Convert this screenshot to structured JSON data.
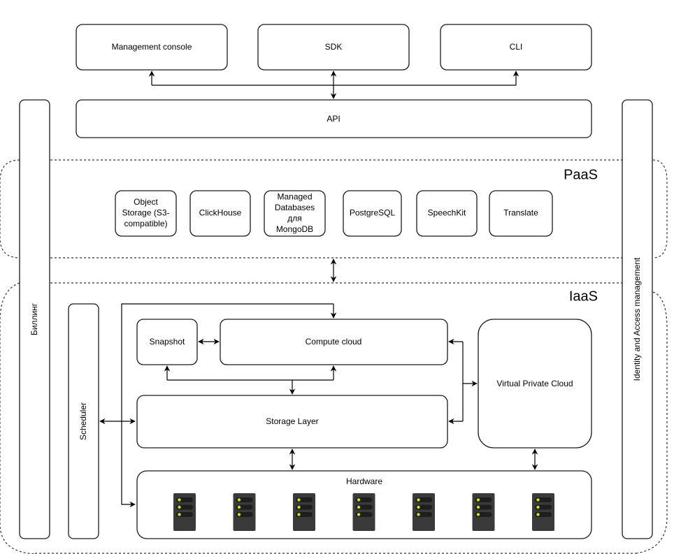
{
  "top": {
    "management_console": "Management console",
    "sdk": "SDK",
    "cli": "CLI",
    "api": "API"
  },
  "sidebars": {
    "billing": "Биллинг",
    "iam": "Identity and Access management"
  },
  "paas": {
    "title": "PaaS",
    "services": [
      {
        "lines": [
          "Object",
          "Storage (S3-",
          "compatible)"
        ]
      },
      {
        "lines": [
          "ClickHouse"
        ]
      },
      {
        "lines": [
          "Managed",
          "Databases",
          "для",
          "MongoDB"
        ]
      },
      {
        "lines": [
          "PostgreSQL"
        ]
      },
      {
        "lines": [
          "SpeechKit"
        ]
      },
      {
        "lines": [
          "Translate"
        ]
      }
    ]
  },
  "iaas": {
    "title": "IaaS",
    "scheduler": "Scheduler",
    "snapshot": "Snapshot",
    "compute_cloud": "Compute cloud",
    "storage_layer": "Storage Layer",
    "vpc": "Virtual Private Cloud",
    "hardware": "Hardware",
    "server_count": 7
  },
  "colors": {
    "server_body": "#3a3a3a",
    "server_slot": "#1e1e1e",
    "server_led": "#c8e02a"
  }
}
